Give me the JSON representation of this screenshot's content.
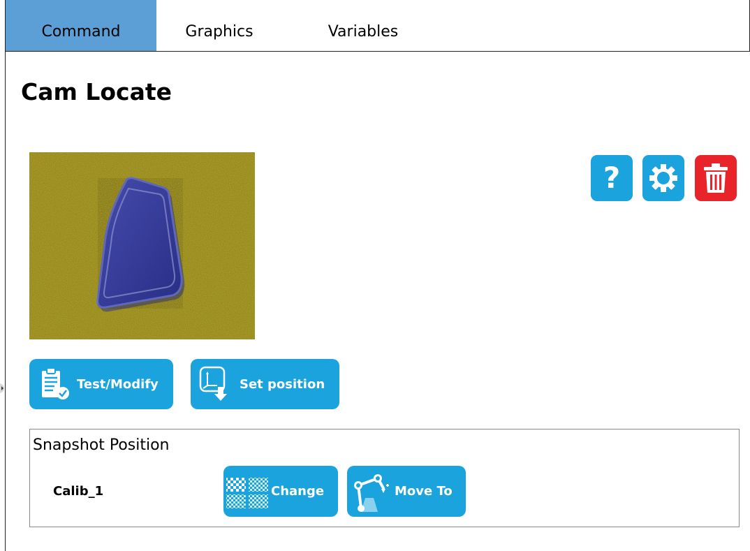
{
  "tabs": [
    {
      "label": "Command",
      "active": true
    },
    {
      "label": "Graphics",
      "active": false
    },
    {
      "label": "Variables",
      "active": false
    }
  ],
  "page_title": "Cam Locate",
  "toolbar": {
    "help_icon": "question-mark-icon",
    "settings_icon": "gear-icon",
    "delete_icon": "trash-icon",
    "help_label": "?"
  },
  "camera_view": {
    "background_color": "#b5a629",
    "part_color": "#3d44a8"
  },
  "actions": {
    "test_modify": {
      "label": "Test/Modify",
      "icon": "clipboard-check-icon"
    },
    "set_position": {
      "label": "Set position",
      "icon": "axes-download-icon"
    }
  },
  "snapshot": {
    "title": "Snapshot Position",
    "position_name": "Calib_1",
    "change": {
      "label": "Change",
      "icon": "checkerboard-icon"
    },
    "move_to": {
      "label": "Move To",
      "icon": "robot-arm-icon"
    }
  },
  "colors": {
    "accent_blue": "#1aa3dc",
    "active_tab": "#5b9fd6",
    "danger_red": "#e8232a"
  }
}
